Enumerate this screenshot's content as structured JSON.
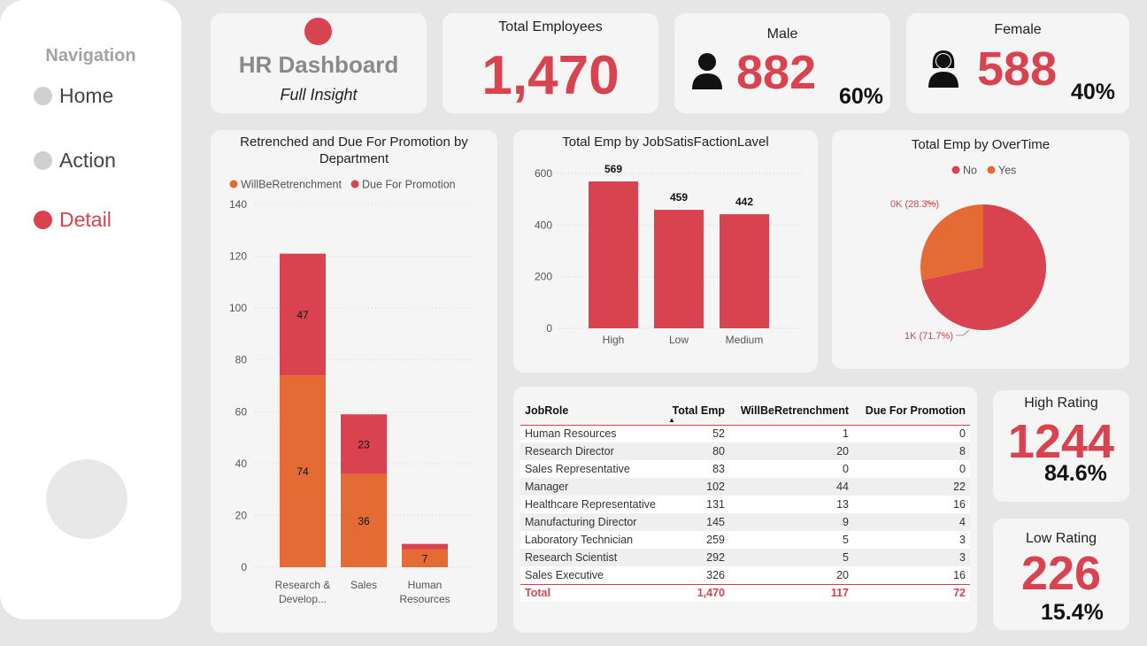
{
  "nav": {
    "title": "Navigation",
    "items": [
      {
        "label": "Home",
        "active": false
      },
      {
        "label": "Action",
        "active": false
      },
      {
        "label": "Detail",
        "active": true
      }
    ]
  },
  "header": {
    "title": "HR Dashboard",
    "subtitle": "Full Insight"
  },
  "kpis": {
    "total_employees": {
      "label": "Total Employees",
      "value": "1,470"
    },
    "male": {
      "label": "Male",
      "value": "882",
      "pct": "60%",
      "icon": "male-user-icon"
    },
    "female": {
      "label": "Female",
      "value": "588",
      "pct": "40%",
      "icon": "female-user-icon"
    },
    "high_rating": {
      "label": "High Rating",
      "value": "1244",
      "pct": "84.6%"
    },
    "low_rating": {
      "label": "Low Rating",
      "value": "226",
      "pct": "15.4%"
    }
  },
  "colors": {
    "accent": "#d9434f",
    "orange": "#e56b35",
    "panel": "#f5f5f5",
    "background": "#e6e6e6"
  },
  "chart_data": [
    {
      "type": "bar",
      "stacked": true,
      "title": "Retrenched and Due For Promotion by Department",
      "categories": [
        "Research & Develop...",
        "Sales",
        "Human Resources"
      ],
      "category_lines": [
        [
          "Research &",
          "Develop..."
        ],
        [
          "Sales"
        ],
        [
          "Human",
          "Resources"
        ]
      ],
      "series": [
        {
          "name": "WillBeRetrenchment",
          "values": [
            74,
            36,
            7
          ],
          "color": "#e56b35"
        },
        {
          "name": "Due For Promotion",
          "values": [
            47,
            23,
            2
          ],
          "color": "#d9434f"
        }
      ],
      "data_labels": [
        [
          "74",
          "36",
          "7"
        ],
        [
          "47",
          "23",
          ""
        ]
      ],
      "yticks": [
        0,
        20,
        40,
        60,
        80,
        100,
        120,
        140
      ],
      "ylim": [
        0,
        140
      ],
      "legend": "top-left",
      "grid": true
    },
    {
      "type": "bar",
      "title": "Total Emp by JobSatisFactionLavel",
      "categories": [
        "High",
        "Low",
        "Medium"
      ],
      "values": [
        569,
        459,
        442
      ],
      "yticks": [
        0,
        200,
        400,
        600
      ],
      "ylim": [
        0,
        600
      ],
      "grid": true
    },
    {
      "type": "pie",
      "title": "Total Emp by OverTime",
      "legend": "top",
      "slices": [
        {
          "name": "No",
          "value": 1054,
          "label": "1K (71.7%)",
          "color": "#d9434f"
        },
        {
          "name": "Yes",
          "value": 416,
          "label": "0K (28.3%)",
          "color": "#e56b35"
        }
      ]
    },
    {
      "type": "table",
      "columns": [
        "JobRole",
        "Total Emp",
        "WillBeRetrenchment",
        "Due For Promotion"
      ],
      "rows": [
        [
          "Human Resources",
          "52",
          "1",
          "0"
        ],
        [
          "Research Director",
          "80",
          "20",
          "8"
        ],
        [
          "Sales Representative",
          "83",
          "0",
          "0"
        ],
        [
          "Manager",
          "102",
          "44",
          "22"
        ],
        [
          "Healthcare Representative",
          "131",
          "13",
          "16"
        ],
        [
          "Manufacturing Director",
          "145",
          "9",
          "4"
        ],
        [
          "Laboratory Technician",
          "259",
          "5",
          "3"
        ],
        [
          "Research Scientist",
          "292",
          "5",
          "3"
        ],
        [
          "Sales Executive",
          "326",
          "20",
          "16"
        ]
      ],
      "total": [
        "Total",
        "1,470",
        "117",
        "72"
      ],
      "sort": {
        "column": "Total Emp",
        "direction": "ascending"
      }
    }
  ]
}
